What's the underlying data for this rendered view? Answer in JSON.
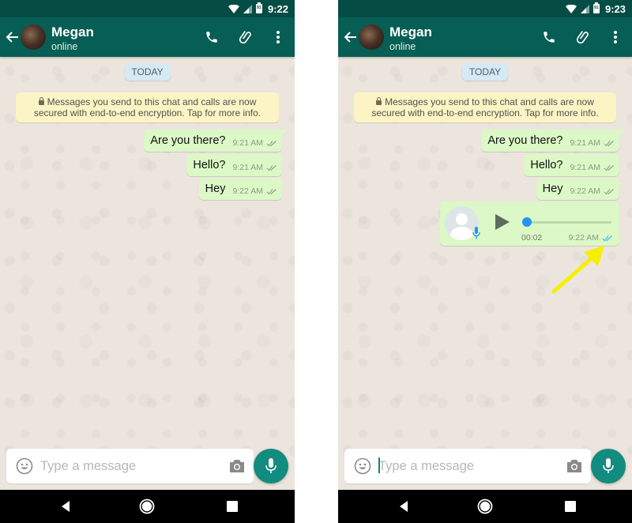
{
  "screens": [
    {
      "status_bar": {
        "time": "9:22",
        "battery_label": "91"
      },
      "toolbar": {
        "contact_name": "Megan",
        "contact_status": "online"
      },
      "chat": {
        "day_chip": "TODAY",
        "encryption_notice": "Messages you send to this chat and calls are now secured with end-to-end encryption. Tap for more info.",
        "messages": [
          {
            "text": "Are you there?",
            "time": "9:21 AM",
            "status": "delivered"
          },
          {
            "text": "Hello?",
            "time": "9:21 AM",
            "status": "delivered"
          },
          {
            "text": "Hey",
            "time": "9:22 AM",
            "status": "delivered"
          }
        ]
      },
      "input": {
        "placeholder": "Type a message",
        "value": ""
      }
    },
    {
      "status_bar": {
        "time": "9:23",
        "battery_label": "91"
      },
      "toolbar": {
        "contact_name": "Megan",
        "contact_status": "online"
      },
      "chat": {
        "day_chip": "TODAY",
        "encryption_notice": "Messages you send to this chat and calls are now secured with end-to-end encryption. Tap for more info.",
        "messages": [
          {
            "text": "Are you there?",
            "time": "9:21 AM",
            "status": "delivered"
          },
          {
            "text": "Hello?",
            "time": "9:21 AM",
            "status": "delivered"
          },
          {
            "text": "Hey",
            "time": "9:22 AM",
            "status": "delivered"
          }
        ],
        "voice_message": {
          "duration": "00:02",
          "time": "9:22 AM",
          "status": "played",
          "progress": 0
        }
      },
      "input": {
        "placeholder": "Type a message",
        "value": ""
      },
      "annotation": {
        "type": "arrow",
        "color": "#f5f000",
        "points_to": "voice-message-played-ticks"
      }
    }
  ],
  "colors": {
    "toolbar": "#075e54",
    "status_bar": "#054d44",
    "outgoing_bubble": "#dcf8c6",
    "read_ticks": "#4fc3f7",
    "delivered_ticks": "#92a58c",
    "mic_button": "#128c7e",
    "progress_thumb": "#2196f3"
  },
  "icons": {
    "back": "arrow-left-icon",
    "call": "phone-icon",
    "attach": "paperclip-icon",
    "menu": "more-vert-icon",
    "emoji": "smiley-icon",
    "camera": "camera-icon",
    "mic": "microphone-icon",
    "play": "play-icon",
    "nav_back": "triangle-back-icon",
    "nav_home": "circle-home-icon",
    "nav_recent": "square-recents-icon"
  }
}
